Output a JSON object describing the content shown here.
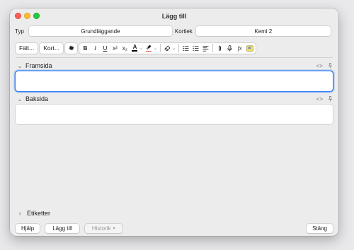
{
  "window": {
    "title": "Lägg till"
  },
  "type_row": {
    "type_label": "Typ",
    "type_value": "Grundläggande",
    "deck_label": "Kortlek",
    "deck_value": "Kemi 2"
  },
  "toolbar": {
    "fields_button": "Fält...",
    "cards_button": "Kort...",
    "bold": "B",
    "italic": "I",
    "underline": "U",
    "superscript": "x²",
    "subscript": "x₂",
    "text_color": "A",
    "text_color_value": "#000000",
    "highlight_color_value": "#e53935",
    "mathjax": "fx"
  },
  "fields": [
    {
      "name": "Framsida",
      "value": "",
      "focused": true
    },
    {
      "name": "Baksida",
      "value": "",
      "focused": false
    }
  ],
  "tags": {
    "label": "Etiketter"
  },
  "bottom": {
    "help_button": "Hjälp",
    "add_button": "Lägg till",
    "history_button": "Historik",
    "history_arrow": "▾",
    "close_button": "Stäng"
  },
  "colors": {
    "focus_ring": "#3b82f6",
    "window_bg": "#ececec"
  }
}
